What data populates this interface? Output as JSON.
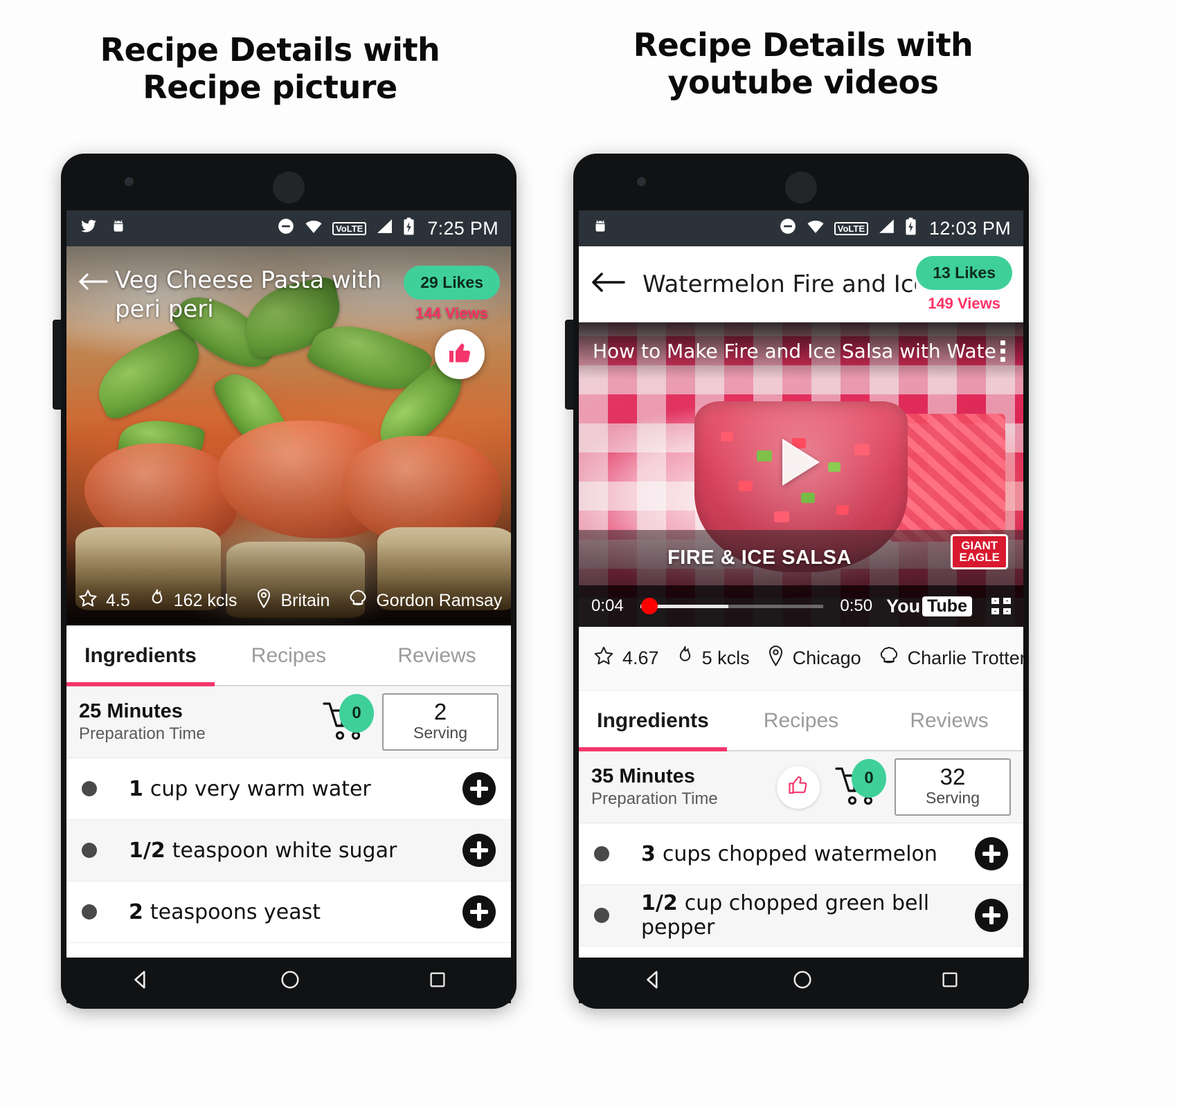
{
  "captions": {
    "left": "Recipe Details with\nRecipe picture",
    "right": "Recipe Details with\nyoutube videos"
  },
  "colors": {
    "accent_pink": "#f4356b",
    "likes_green": "#3fd09a",
    "views_pink": "#ff3366",
    "statusbar": "#2b3239",
    "youtube_red": "#ff0000"
  },
  "left_phone": {
    "statusbar": {
      "icons": [
        "twitter-icon",
        "android-icon",
        "do-not-disturb-icon",
        "wifi-icon",
        "volte-icon",
        "signal-icon",
        "battery-charging-icon"
      ],
      "volte_label": "VoLTE",
      "time": "7:25 PM"
    },
    "hero": {
      "back_icon": "back-arrow-icon",
      "title": "Veg Cheese Pasta with peri peri",
      "likes": "29 Likes",
      "views": "144 Views",
      "fab_icon": "thumbs-up-icon"
    },
    "meta": [
      {
        "icon": "star-icon",
        "label": "4.5"
      },
      {
        "icon": "flame-icon",
        "label": "162 kcls"
      },
      {
        "icon": "location-pin-icon",
        "label": "Britain"
      },
      {
        "icon": "chef-hat-icon",
        "label": "Gordon Ramsay"
      }
    ],
    "tabs": [
      {
        "label": "Ingredients",
        "active": true
      },
      {
        "label": "Recipes",
        "active": false
      },
      {
        "label": "Reviews",
        "active": false
      }
    ],
    "prep": {
      "time": "25 Minutes",
      "sub": "Preparation Time",
      "cart_icon": "shopping-cart-icon",
      "cart_count": "0",
      "serving_value": "2",
      "serving_label": "Serving",
      "show_like": false
    },
    "ingredients": [
      {
        "qty": "1",
        "name": "cup very warm water"
      },
      {
        "qty": "1/2",
        "name": "teaspoon white sugar"
      },
      {
        "qty": "2",
        "name": "teaspoons yeast"
      }
    ],
    "navbar": [
      "back-triangle-icon",
      "home-circle-icon",
      "recents-square-icon"
    ]
  },
  "right_phone": {
    "statusbar": {
      "icons": [
        "android-icon",
        "do-not-disturb-icon",
        "wifi-icon",
        "volte-icon",
        "signal-icon",
        "battery-charging-icon"
      ],
      "volte_label": "VoLTE",
      "time": "12:03 PM"
    },
    "appbar": {
      "back_icon": "back-arrow-icon",
      "title": "Watermelon Fire and Ice …",
      "likes": "13 Likes",
      "views": "149 Views"
    },
    "video": {
      "title": "How to Make Fire and Ice Salsa with Waterm…",
      "menu_icon": "kebab-menu-icon",
      "play_icon": "play-icon",
      "lower_third": "FIRE & ICE SALSA",
      "brand_line1": "GIANT",
      "brand_line2": "EAGLE",
      "current_time": "0:04",
      "duration": "0:50",
      "progress_percent": 5,
      "buffered_percent": 48,
      "youtube_you": "You",
      "youtube_tube": "Tube",
      "fullscreen_icon": "fullscreen-icon"
    },
    "meta": [
      {
        "icon": "star-icon",
        "label": "4.67"
      },
      {
        "icon": "flame-icon",
        "label": "5 kcls"
      },
      {
        "icon": "location-pin-icon",
        "label": "Chicago"
      },
      {
        "icon": "chef-hat-icon",
        "label": "Charlie Trotter"
      }
    ],
    "tabs": [
      {
        "label": "Ingredients",
        "active": true
      },
      {
        "label": "Recipes",
        "active": false
      },
      {
        "label": "Reviews",
        "active": false
      }
    ],
    "prep": {
      "time": "35 Minutes",
      "sub": "Preparation Time",
      "like_icon": "thumbs-up-outline-icon",
      "cart_icon": "shopping-cart-icon",
      "cart_count": "0",
      "serving_value": "32",
      "serving_label": "Serving",
      "show_like": true
    },
    "ingredients": [
      {
        "qty": "3",
        "name": "cups chopped watermelon"
      },
      {
        "qty": "1/2",
        "name": "cup chopped green bell pepper"
      }
    ],
    "navbar": [
      "back-triangle-icon",
      "home-circle-icon",
      "recents-square-icon"
    ]
  }
}
